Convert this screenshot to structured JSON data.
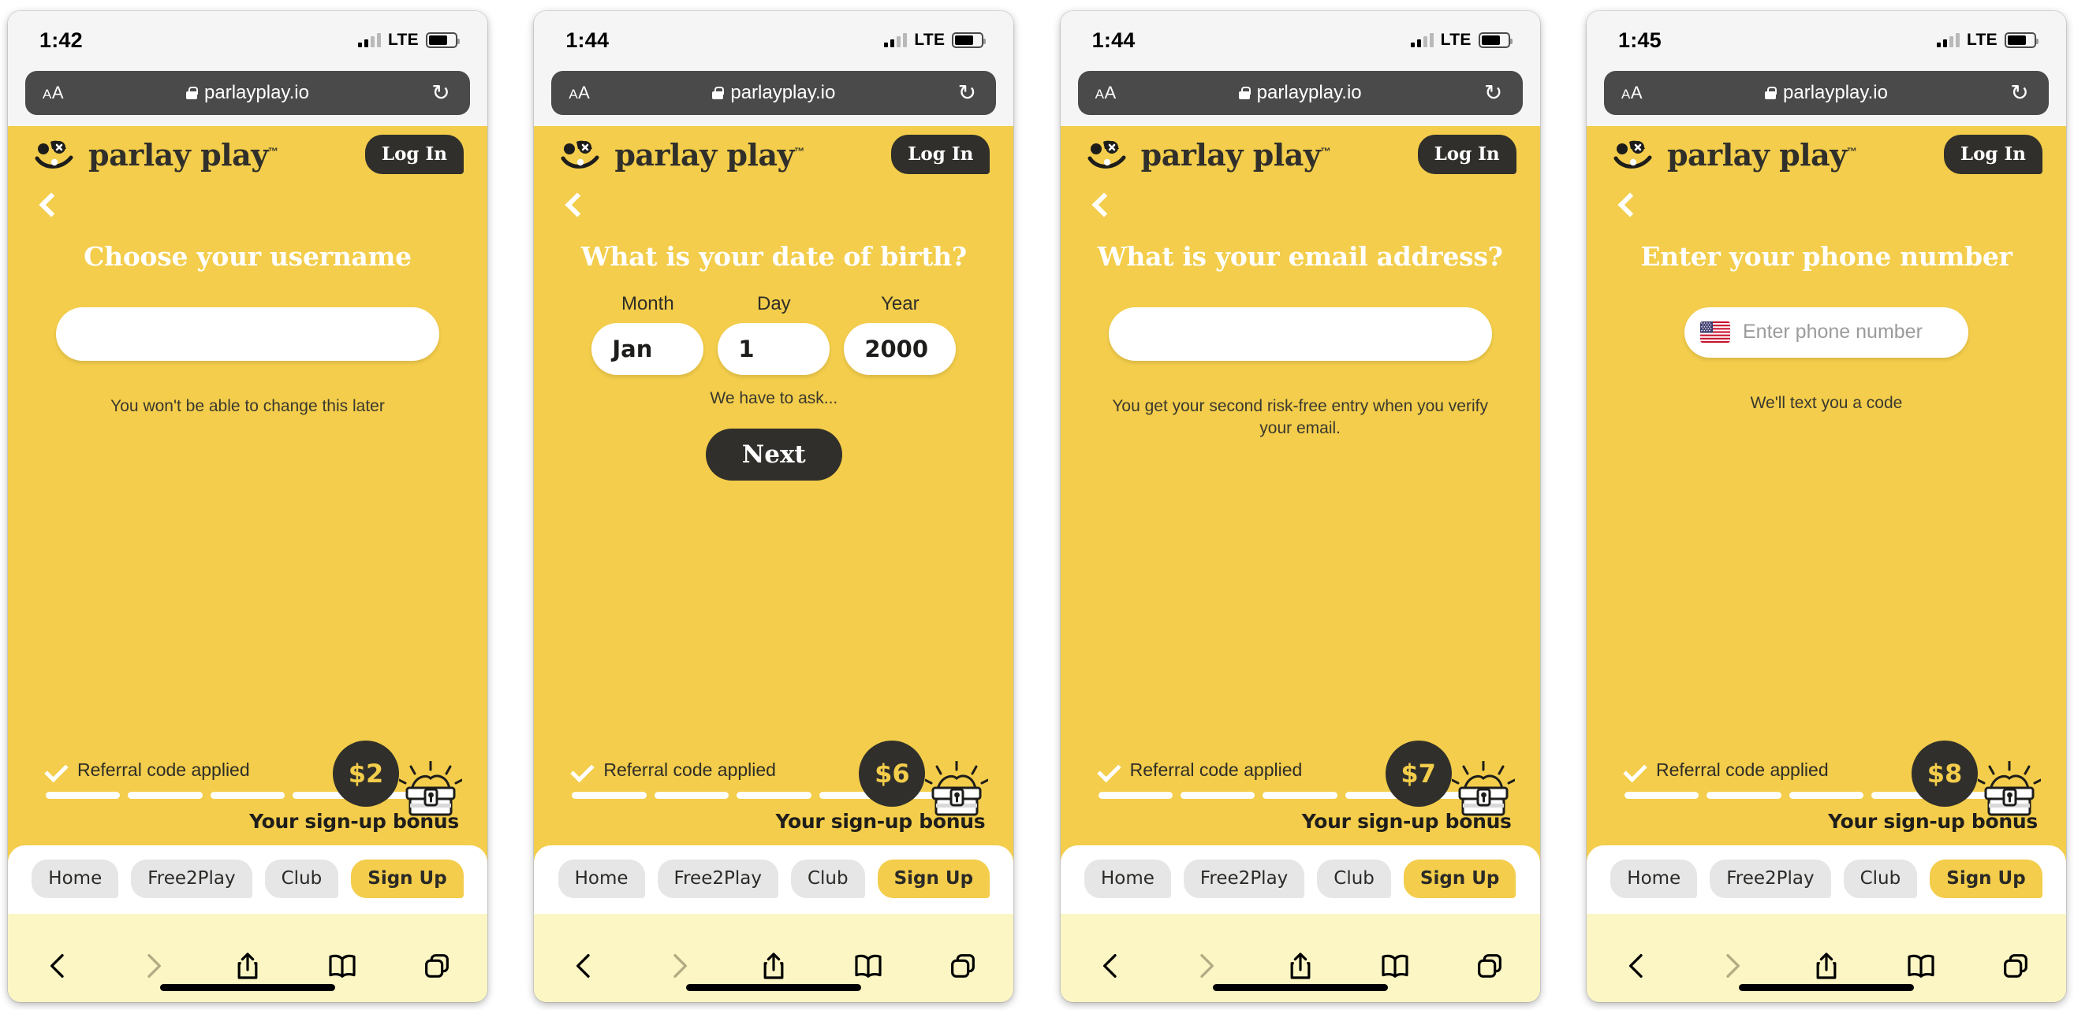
{
  "browser": {
    "url_text": "parlayplay.io",
    "aa_label_big": "A",
    "aa_label_small": "A",
    "reload_glyph": "↻",
    "lte_label": "LTE",
    "toolbar": {
      "back": "back-icon",
      "forward": "forward-icon",
      "share": "share-icon",
      "bookmarks": "bookmarks-icon",
      "tabs": "tabs-icon"
    }
  },
  "app": {
    "brand": "parlay play",
    "trademark": "™",
    "login_label": "Log In",
    "referral_text": "Referral code applied",
    "bonus_caption": "Your sign-up bonus",
    "tabs": [
      {
        "label": "Home",
        "active": false
      },
      {
        "label": "Free2Play",
        "active": false
      },
      {
        "label": "Club",
        "active": false
      },
      {
        "label": "Sign Up",
        "active": true
      }
    ],
    "colors": {
      "brand_yellow": "#f3cd4b",
      "dark": "#302f2b",
      "safari_bar": "#fbf6c4",
      "tab_inactive": "#e6e6e6"
    }
  },
  "panels": [
    {
      "time": "1:42",
      "title": "Choose your username",
      "input_value": "",
      "input_placeholder": "",
      "helper": "You won't be able to change this later",
      "bonus_amount": "$2",
      "progress_segments": 5
    },
    {
      "time": "1:44",
      "title": "What is your date of birth?",
      "dob": {
        "month_label": "Month",
        "day_label": "Day",
        "year_label": "Year",
        "month_value": "Jan",
        "day_value": "1",
        "year_value": "2000"
      },
      "dob_note": "We have to ask...",
      "next_label": "Next",
      "bonus_amount": "$6",
      "progress_segments": 5
    },
    {
      "time": "1:44",
      "title": "What is your email address?",
      "input_value": "",
      "input_placeholder": "",
      "helper": "You get your second risk-free entry when you verify your email.",
      "bonus_amount": "$7",
      "progress_segments": 5
    },
    {
      "time": "1:45",
      "title": "Enter your phone number",
      "phone_placeholder": "Enter phone number",
      "flag": "us-flag-icon",
      "helper": "We'll text you a code",
      "bonus_amount": "$8",
      "progress_segments": 5
    }
  ]
}
